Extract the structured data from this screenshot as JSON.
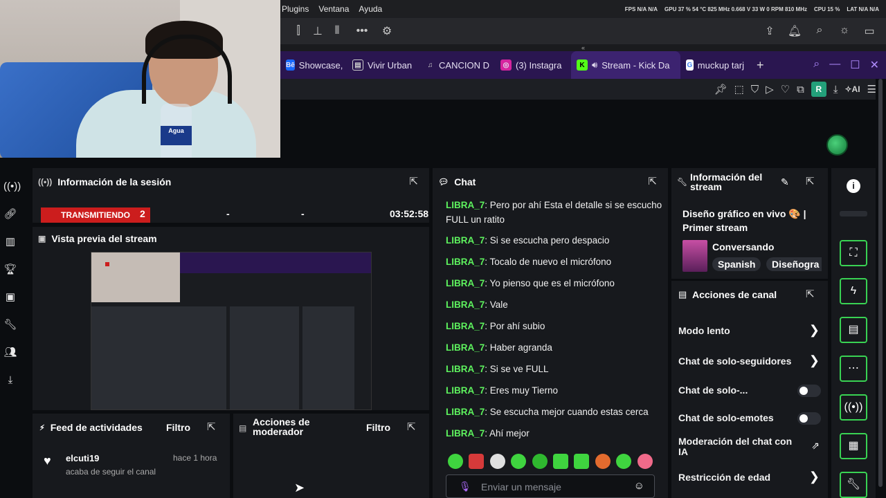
{
  "webcam": {
    "bottle_label": "Agua"
  },
  "os_menu": [
    "Plugins",
    "Ventana",
    "Ayuda"
  ],
  "os_stats": {
    "fps": "FPS  N/A  N/A",
    "gpu": "GPU 37 %  54 °C  825 MHz  0.668 V  33 W  0 RPM  810 MHz",
    "cpu": "CPU 15 %",
    "lat": "LAT  N/A  N/A"
  },
  "tabs": [
    {
      "label": "Showcase,",
      "icon": "behance-icon",
      "color": "#1769ff"
    },
    {
      "label": "Vivir Urban",
      "icon": "document-icon",
      "color": "#555"
    },
    {
      "label": "CANCION D",
      "icon": "music-icon",
      "color": "#555"
    },
    {
      "label": "(3) Instagra",
      "icon": "instagram-icon",
      "color": "#d6249f"
    },
    {
      "label": "Stream - Kick Da",
      "icon": "kick-icon",
      "color": "#53fc18"
    },
    {
      "label": "muckup tarj",
      "icon": "google-icon",
      "color": "#4285f4"
    }
  ],
  "session": {
    "title": "Información de la sesión",
    "status": "TRANSMITIENDO",
    "viewers": "2",
    "dash1": "-",
    "dash2": "-",
    "duration": "03:52:58"
  },
  "preview": {
    "title": "Vista previa del stream"
  },
  "feed": {
    "title": "Feed de actividades",
    "filter": "Filtro",
    "item": {
      "user": "elcuti19",
      "time": "hace 1 hora",
      "text": "acaba de seguir el canal"
    }
  },
  "mod_actions": {
    "title": "Acciones de moderador",
    "filter": "Filtro"
  },
  "chat": {
    "title": "Chat",
    "messages": [
      {
        "user": "LIBRA_7",
        "text": "Pero por ahí Esta el detalle si se escucho FULL un ratito"
      },
      {
        "user": "LIBRA_7",
        "text": "Si se escucha pero despacio"
      },
      {
        "user": "LIBRA_7",
        "text": "Tocalo de nuevo el micrófono"
      },
      {
        "user": "LIBRA_7",
        "text": "Yo pienso que es el micrófono"
      },
      {
        "user": "LIBRA_7",
        "text": "Vale"
      },
      {
        "user": "LIBRA_7",
        "text": "Por ahí subio"
      },
      {
        "user": "LIBRA_7",
        "text": "Haber agranda"
      },
      {
        "user": "LIBRA_7",
        "text": "Si se ve FULL"
      },
      {
        "user": "LIBRA_7",
        "text": "Eres muy Tierno"
      },
      {
        "user": "LIBRA_7",
        "text": "Se escucha mejor cuando estas cerca"
      },
      {
        "user": "LIBRA_7",
        "text": "Ahí mejor"
      }
    ],
    "input_placeholder": "Enviar un mensaje"
  },
  "stream_info": {
    "title": "Información del stream",
    "stream_title": "Diseño gráfico en vivo 🎨 | Primer stream",
    "category": "Conversando",
    "tags": [
      "Spanish",
      "Diseñogra"
    ]
  },
  "channel_actions": {
    "title": "Acciones de canal",
    "items": [
      {
        "label": "Modo lento",
        "control": "chevron"
      },
      {
        "label": "Chat de solo-seguidores",
        "control": "chevron"
      },
      {
        "label": "Chat de solo-...",
        "control": "toggle"
      },
      {
        "label": "Chat de solo-emotes",
        "control": "toggle"
      },
      {
        "label": "Moderación del chat con IA",
        "control": "external"
      },
      {
        "label": "Restricción de edad",
        "control": "chevron"
      }
    ]
  },
  "addr_badge": "R",
  "addr_ai": "AI",
  "colors": {
    "accent": "#53fc18",
    "live": "#cc1d1d",
    "browser_tabbar": "#2a1650"
  }
}
